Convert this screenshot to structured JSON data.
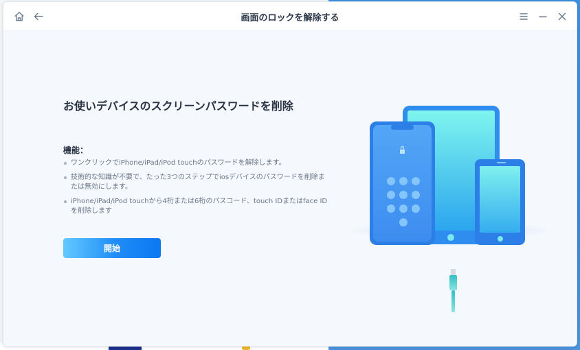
{
  "window": {
    "title": "画面のロックを解除する"
  },
  "titlebar": {
    "icons": [
      "home-icon",
      "back-arrow-icon",
      "menu-icon",
      "minimize-icon",
      "close-icon"
    ]
  },
  "main": {
    "heading": "お使いデバイスのスクリーンパスワードを削除",
    "features_title": "機能：",
    "features": [
      "ワンクリックでiPhone/iPad/iPod touchのパスワードを解除します。",
      "技術的な知識が不要で、たった3つのステップでiosデバイスのパスワードを削除または無効にします。",
      "iPhone/iPad/iPod touchから4桁または6桁のパスコード、touch IDまたはface IDを削除します"
    ],
    "start_button": "開始"
  },
  "colors": {
    "accent": "#1f8cf7",
    "button_start": "#62c9ff",
    "button_end": "#0c78f2",
    "window_bg": "#f5f8fd",
    "text_dark": "#2a3344",
    "text_muted": "#6a7585"
  }
}
